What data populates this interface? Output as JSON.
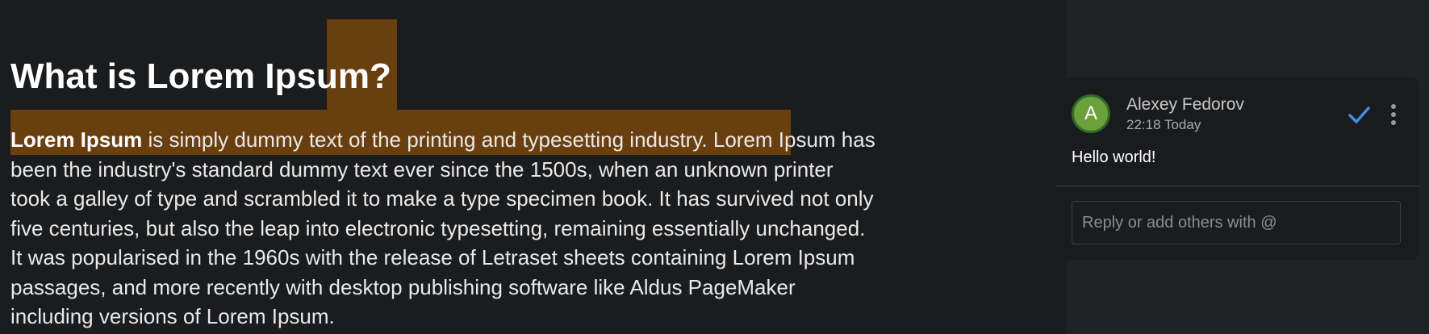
{
  "document": {
    "title": "What is Lorem Ipsum?",
    "lead_bold": "Lorem Ipsum",
    "lines": [
      " is simply dummy text of the printing and typesetting industry. Lorem Ipsum has",
      "been the industry's standard dummy text ever since the 1500s, when an unknown printer",
      "took a galley of type and scrambled it to make a type specimen book. It has survived not only",
      "five centuries, but also the leap into electronic typesetting, remaining essentially unchanged.",
      "It was popularised in the 1960s with the release of Letraset sheets containing Lorem Ipsum",
      "passages, and more recently with desktop publishing software like Aldus PageMaker",
      "including versions of Lorem Ipsum."
    ]
  },
  "comment": {
    "avatar_initial": "A",
    "author": "Alexey Fedorov",
    "time": "22:18 Today",
    "text": "Hello world!",
    "resolve_icon": "check-icon",
    "more_icon": "more-vertical-icon"
  },
  "reply": {
    "placeholder": "Reply or add others with @",
    "value": ""
  },
  "colors": {
    "background": "#1b1c1e",
    "sidebar": "#1f2123",
    "highlight": "#6a3f10",
    "avatar": "#6ba03a",
    "accent": "#3d8fe5"
  }
}
